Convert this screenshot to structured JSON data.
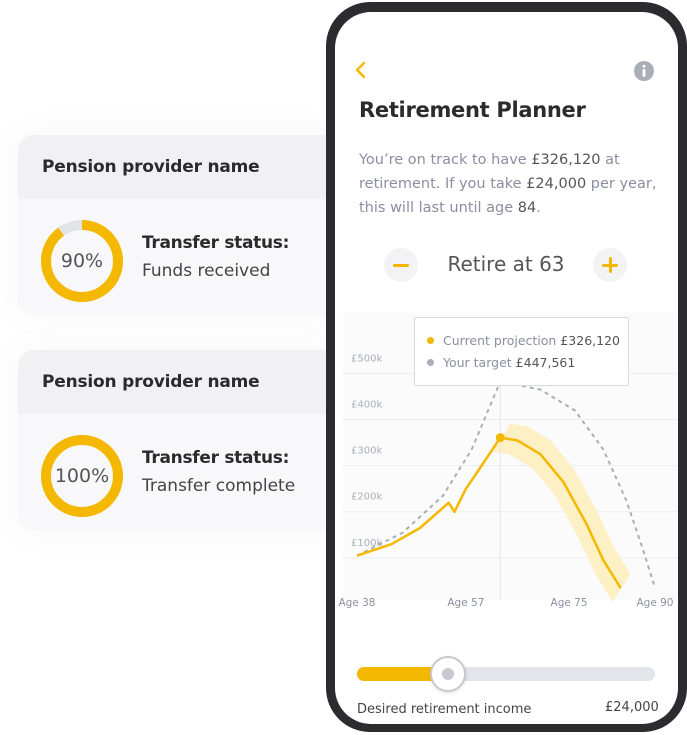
{
  "cards": [
    {
      "provider": "Pension provider name",
      "percent_label": "90%",
      "progress": 0.9,
      "status_title": "Transfer status:",
      "status_value": "Funds received"
    },
    {
      "provider": "Pension provider name",
      "percent_label": "100%",
      "progress": 1.0,
      "status_title": "Transfer status:",
      "status_value": "Transfer complete"
    }
  ],
  "app": {
    "title": "Retirement Planner",
    "summary": {
      "p1": "You’re on track to have ",
      "amount": "£326,120",
      "p2": " at retirement. If you take ",
      "yearly": "£24,000",
      "p3": " per year, this will last until age ",
      "age": "84",
      "p4": "."
    },
    "retire_label": "Retire at 63"
  },
  "tooltip": {
    "current_label": "Current projection",
    "current_value": "£326,120",
    "target_label": "Your target",
    "target_value": "£447,561"
  },
  "slider": {
    "label": "Desired retirement income",
    "value": "£24,000",
    "progress": 0.3
  },
  "colors": {
    "accent": "#f5b800",
    "target": "#a9aeb7",
    "band": "#fdf0c4",
    "text_muted": "#8a8fa0"
  },
  "chart_data": {
    "type": "line",
    "x_ticks": [
      "Age 38",
      "Age 57",
      "Age 75",
      "Age 90"
    ],
    "y_ticks": [
      "£500k",
      "£400k",
      "£300k",
      "£200k",
      "£100k"
    ],
    "ylim": [
      0,
      500000
    ],
    "xlim": [
      38,
      90
    ],
    "series": [
      {
        "name": "Current projection",
        "points": [
          [
            38,
            70000
          ],
          [
            44,
            95000
          ],
          [
            49,
            130000
          ],
          [
            54,
            185000
          ],
          [
            55,
            165000
          ],
          [
            57,
            215000
          ],
          [
            60,
            270000
          ],
          [
            63,
            326120
          ],
          [
            66,
            320000
          ],
          [
            70,
            290000
          ],
          [
            74,
            230000
          ],
          [
            78,
            140000
          ],
          [
            81,
            60000
          ],
          [
            84,
            0
          ]
        ]
      },
      {
        "name": "Your target",
        "points": [
          [
            38,
            70000
          ],
          [
            46,
            120000
          ],
          [
            53,
            200000
          ],
          [
            58,
            300000
          ],
          [
            63,
            447561
          ],
          [
            70,
            430000
          ],
          [
            76,
            385000
          ],
          [
            81,
            300000
          ],
          [
            85,
            190000
          ],
          [
            88,
            80000
          ],
          [
            90,
            0
          ]
        ]
      }
    ]
  }
}
